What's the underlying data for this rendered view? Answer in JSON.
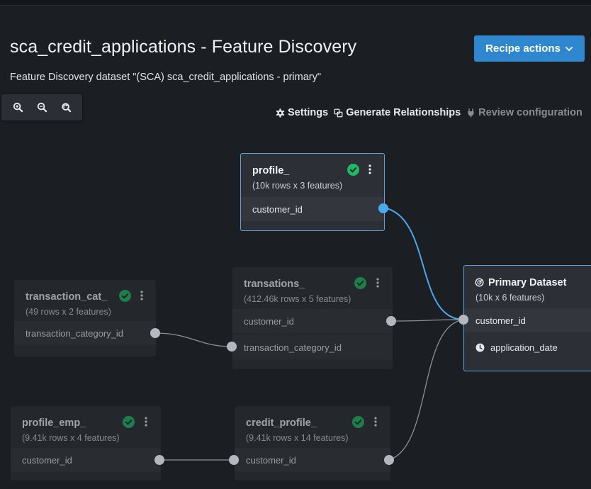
{
  "page": {
    "title": "sca_credit_applications - Feature Discovery",
    "subtitle": "Feature Discovery dataset \"(SCA) sca_credit_applications - primary\""
  },
  "header": {
    "recipe_actions_label": "Recipe actions"
  },
  "zoom": {
    "in_icon": "zoom-in-icon",
    "out_icon": "zoom-out-icon",
    "reset_icon": "zoom-reset-icon"
  },
  "toolbar": {
    "settings_label": "Settings",
    "generate_label": "Generate Relationships",
    "review_label": "Review configuration"
  },
  "colors": {
    "accent": "#2e87cf",
    "edge_active": "#4aa8ec",
    "check": "#1fb866"
  },
  "cards": {
    "profile": {
      "name": "profile_",
      "meta": "(10k rows x 3 features)",
      "rows": [
        "customer_id"
      ]
    },
    "transaction_cat": {
      "name": "transaction_cat_",
      "meta": "(49 rows x 2 features)",
      "rows": [
        "transaction_category_id"
      ]
    },
    "transations": {
      "name": "transations_",
      "meta": "(412.46k rows x 5 features)",
      "rows": [
        "customer_id",
        "transaction_category_id"
      ]
    },
    "primary": {
      "name": "Primary Dataset",
      "meta": "(10k x 6 features)",
      "rows": [
        "customer_id",
        "application_date"
      ]
    },
    "profile_emp": {
      "name": "profile_emp_",
      "meta": "(9.41k rows x 4 features)",
      "rows": [
        "customer_id"
      ]
    },
    "credit_profile": {
      "name": "credit_profile_",
      "meta": "(9.41k rows x 14 features)",
      "rows": [
        "customer_id"
      ]
    }
  }
}
